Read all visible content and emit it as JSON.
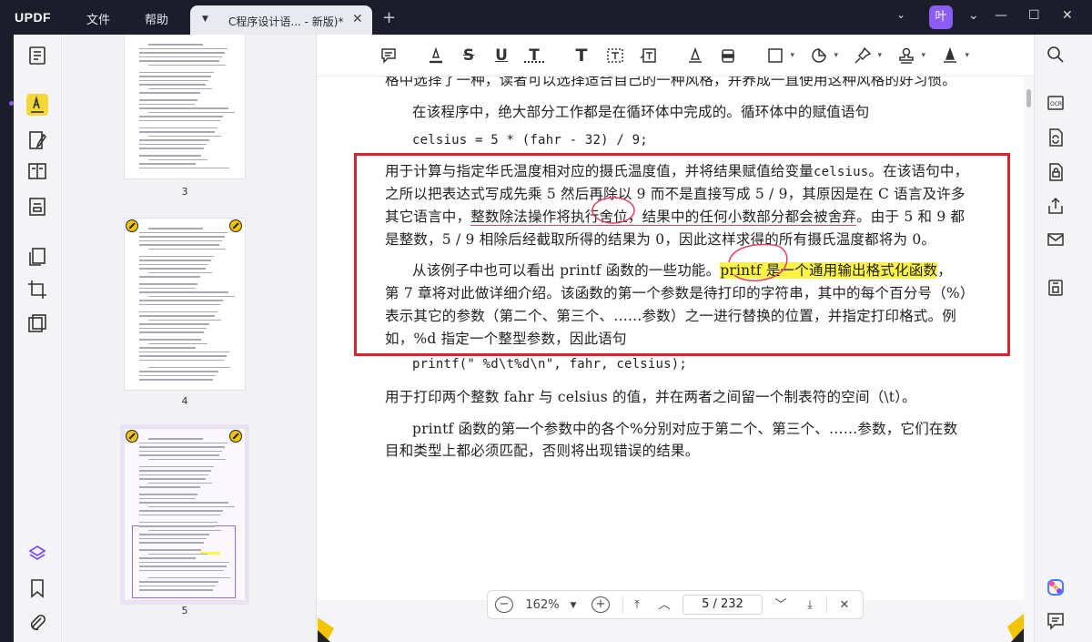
{
  "app": {
    "logo": "UPDF",
    "menu_file": "文件",
    "menu_help": "帮助",
    "avatar_letter": "叶"
  },
  "tab": {
    "title": "C程序设计语... - 新版)*"
  },
  "thumbnails": [
    {
      "page_label": "3"
    },
    {
      "page_label": "4"
    },
    {
      "page_label": "5"
    }
  ],
  "document": {
    "line_top": "格中选择了一种，读者可以选择适合自己的一种风格，并养成一直使用这种风格的好习惯。",
    "para1": "在该程序中，绝大部分工作都是在循环体中完成的。循环体中的赋值语句",
    "code1": "celsius  =  5 * (fahr - 32) / 9;",
    "box_l1_a": "用于计算与指定华氏温度相对应的摄氏温度值，并将结果赋值给变量",
    "box_l1_code": "celsius",
    "box_l1_b": "。在该语句中，",
    "box_l2": "之所以把表达式写成先乘 5 然后再除以 9 而不是直接写成 5 / 9，其原因是在 C 语言及许多",
    "box_l3_a": "其它语言中，",
    "box_l3_ul": "整数除法操作将执行舍位，结果中的任何小数部分都会被舍弃",
    "box_l3_b": "。由于 5 和 9 都",
    "box_l4": "是整数，5 / 9 相除后经截取所得的结果为 0，因此这样求得的所有摄氏温度都将为 0。",
    "box_l5_a": "从该例子中也可以看出 printf 函数的一些功能。",
    "box_l5_hl": "printf 是一个通用输出格式化函数",
    "box_l5_b": "，",
    "box_l6": "第 7 章将对此做详细介绍。该函数的第一个参数是待打印的字符串，其中的每个百分号（%）",
    "box_l7": "表示其它的参数（第二个、第三个、……参数）之一进行替换的位置，并指定打印格式。例",
    "box_l8": "如，%d 指定一个整型参数，因此语句",
    "code2": "printf(\" %d\\t%d\\n\", fahr, celsius);",
    "para2": "用于打印两个整数 fahr 与 celsius 的值，并在两者之间留一个制表符的空间（\\t）。",
    "para3_l1": "printf 函数的第一个参数中的各个%分别对应于第二个、第三个、……参数，它们在数",
    "para3_l2": "目和类型上都必须匹配，否则将出现错误的结果。"
  },
  "navigation": {
    "zoom": "162%",
    "page_indicator": "5 / 232"
  },
  "colors": {
    "titlebar": "#1b1d2b",
    "highlight": "#fbf24a",
    "annotation_red": "#d9232f",
    "underline_pink": "#e8465a",
    "active_tool": "#f4d83a",
    "avatar": "#8b5cf6"
  },
  "icons": {
    "left_tools": [
      "reader-icon",
      "comment-icon",
      "edit-icon",
      "organize-icon",
      "form-icon",
      "pages-icon",
      "crop-icon",
      "protect-icon",
      "layers-icon",
      "bookmark-icon",
      "attachment-icon"
    ],
    "toolbar": [
      "note-icon",
      "highlighter-icon",
      "strikethrough-icon",
      "underline-icon",
      "squiggly-icon",
      "text-icon",
      "textbox-icon",
      "callout-icon",
      "pencil-icon",
      "eraser-icon",
      "shape-icon",
      "sticker-icon",
      "pin-icon",
      "stamp-icon",
      "signature-icon"
    ],
    "right_tools": [
      "search-icon",
      "ocr-icon",
      "convert-icon",
      "protect-file-icon",
      "share-icon",
      "email-icon",
      "save-icon",
      "ai-icon",
      "chat-icon"
    ]
  }
}
